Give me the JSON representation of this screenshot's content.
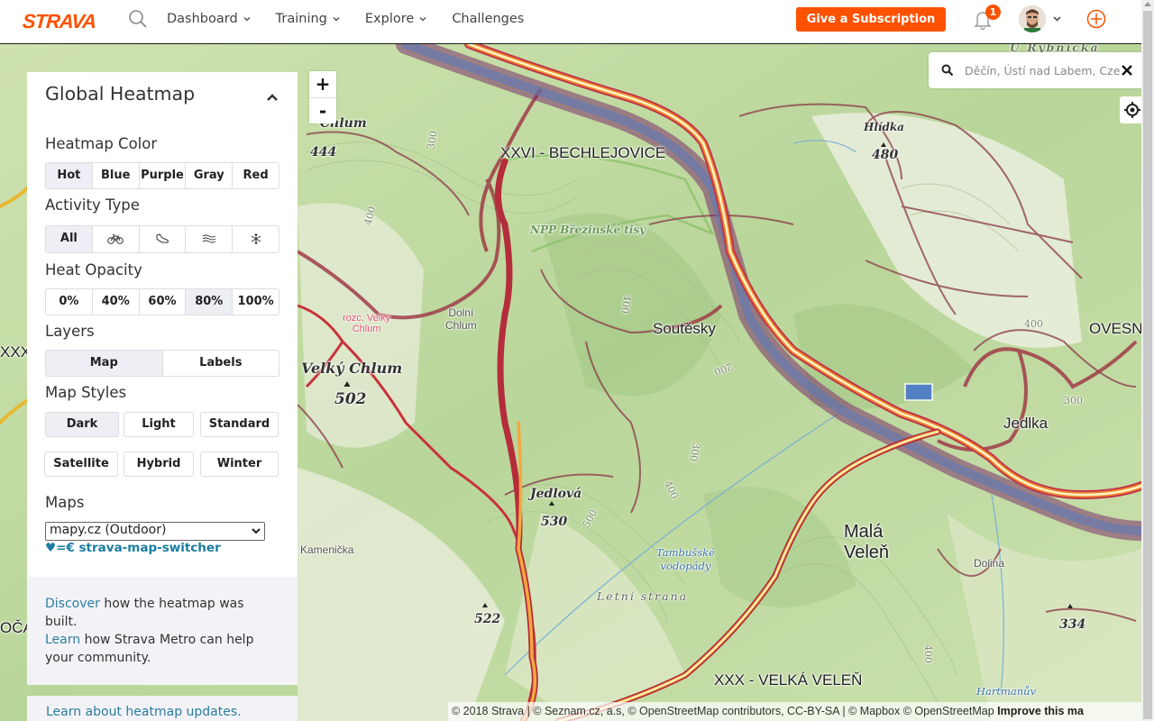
{
  "header": {
    "logo": "STRAVA",
    "nav": [
      {
        "label": "Dashboard",
        "has_dropdown": true
      },
      {
        "label": "Training",
        "has_dropdown": true
      },
      {
        "label": "Explore",
        "has_dropdown": true
      },
      {
        "label": "Challenges",
        "has_dropdown": false
      }
    ],
    "subscription_button": "Give a Subscription",
    "notification_count": "1",
    "brand_color": "#fc5200"
  },
  "panel": {
    "title": "Global Heatmap",
    "heatmap_color": {
      "label": "Heatmap Color",
      "options": [
        "Hot",
        "Blue",
        "Purple",
        "Gray",
        "Red"
      ],
      "selected": "Hot"
    },
    "activity_type": {
      "label": "Activity Type",
      "options": [
        {
          "label": "All",
          "icon": null
        },
        {
          "label": "Ride",
          "icon": "bike-icon"
        },
        {
          "label": "Run",
          "icon": "shoe-icon"
        },
        {
          "label": "Water",
          "icon": "water-icon"
        },
        {
          "label": "Winter",
          "icon": "snowflake-icon"
        }
      ],
      "selected": "All"
    },
    "heat_opacity": {
      "label": "Heat Opacity",
      "options": [
        "0%",
        "40%",
        "60%",
        "80%",
        "100%"
      ],
      "selected": "80%"
    },
    "layers": {
      "label": "Layers",
      "options": [
        "Map",
        "Labels"
      ],
      "selected": "Map"
    },
    "map_styles": {
      "label": "Map Styles",
      "options": [
        "Dark",
        "Light",
        "Standard",
        "Satellite",
        "Hybrid",
        "Winter"
      ],
      "selected": "Dark"
    },
    "maps": {
      "label": "Maps",
      "selected": "mapy.cz (Outdoor)",
      "switcher_link": "♥=€ strava-map-switcher"
    }
  },
  "info": {
    "discover_link": "Discover",
    "discover_text": " how the heatmap was built.",
    "learn_link": "Learn",
    "learn_text": " how Strava Metro can help your community.",
    "updates_link": "Learn about heatmap updates."
  },
  "map": {
    "zoom_in": "+",
    "zoom_out": "-",
    "search_value": "Děčín, Ústí nad Labem, Czech Republic",
    "labels": {
      "bechlejovice": "XXVI - BECHLEJOVICE",
      "velka_velen": "XXX - VELKÁ VELEŇ",
      "soutesky": "Soutěsky",
      "jedlka": "Jedlka",
      "ovesna": "OVESN",
      "mala_velen_1": "Malá",
      "mala_velen_2": "Veleň",
      "dolni_chlum_1": "Dolní",
      "dolni_chlum_2": "Chlum",
      "dolina": "Dolina",
      "kamenicka": "Kamenička",
      "velky_chlum": "Velký Chlum",
      "velky_chlum_elev": "502",
      "rozc_1": "rozc. Velký",
      "rozc_2": "Chlum",
      "chlum": "Chlum",
      "chlum_elev": "444",
      "jedlova": "Jedlová",
      "jedlova_elev": "530",
      "peak_522": "522",
      "hlidka": "Hlídka",
      "hlidka_elev": "480",
      "peak_334": "334",
      "npp": "NPP Březinské tisy",
      "waterfalls_1": "Tambušské",
      "waterfalls_2": "vodopády",
      "letni_strana": "Letní strana",
      "hartmanuv": "Hartmanův",
      "rybnicka": "U Rybníčka",
      "left_xxx": "XXX",
      "left_oca": "OČA",
      "contour_300a": "300",
      "contour_400a": "400",
      "contour_400b": "400",
      "contour_200": "200",
      "contour_300b": "300",
      "contour_500": "500",
      "contour_400c": "400",
      "contour_400d": "400",
      "contour_300c": "300",
      "contour_400e": "400"
    },
    "attribution": "© 2018 Strava | © Seznam.cz, a.s, © OpenStreetMap contributors, CC-BY-SA | © Mapbox © OpenStreetMap",
    "improve_link": "Improve this ma"
  }
}
